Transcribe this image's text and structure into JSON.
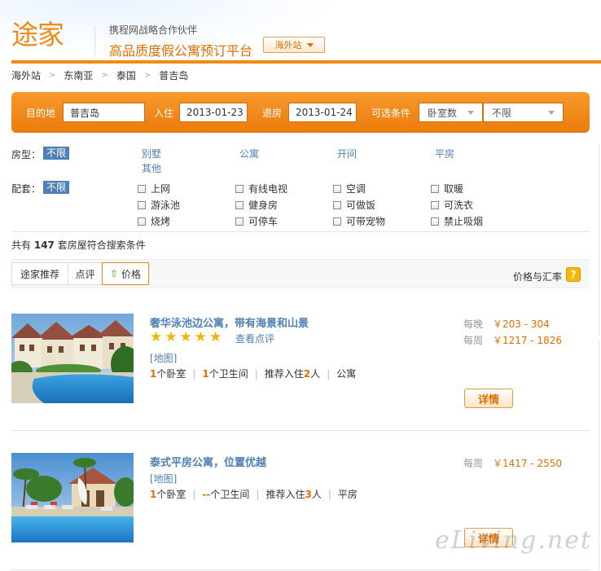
{
  "header": {
    "logo": "途家",
    "partner": "携程网战略合作伙伴",
    "slogan": "高品质度假公寓预订平台",
    "site_switch": "海外站"
  },
  "breadcrumb": [
    "海外站",
    "东南亚",
    "泰国",
    "普吉岛"
  ],
  "search": {
    "destination_label": "目的地",
    "destination_value": "普吉岛",
    "checkin_label": "入住",
    "checkin_value": "2013-01-23",
    "checkout_label": "退房",
    "checkout_value": "2013-01-24",
    "optional_label": "可选条件",
    "bedrooms_select": "卧室数",
    "unlimited_select": "不限"
  },
  "filters": {
    "room_type_label": "房型：",
    "room_type_selected": "不限",
    "room_types": [
      "别墅",
      "公寓",
      "开间",
      "平房",
      "其他"
    ],
    "amenities_label": "配套：",
    "amenities_selected": "不限",
    "amenities": [
      "上网",
      "有线电视",
      "空调",
      "取暖",
      "游泳池",
      "健身房",
      "可做饭",
      "可洗衣",
      "烧烤",
      "可停车",
      "可带宠物",
      "禁止吸烟"
    ]
  },
  "results": {
    "prefix": "共有",
    "count": "147",
    "suffix": "套房屋符合搜索条件"
  },
  "sort": {
    "tabs": [
      "途家推荐",
      "点评",
      "价格"
    ],
    "rate_label": "价格与汇率",
    "help": "?"
  },
  "listings": [
    {
      "title": "奢华泳池边公寓，带有海景和山景",
      "rating": 5,
      "review_link": "查看点评",
      "map": "[地图]",
      "bedrooms_num": "1",
      "bedrooms_unit": "个卧室",
      "bathrooms_num": "1",
      "bathrooms_unit": "个卫生间",
      "guests_prefix": "推荐入住",
      "guests_num": "2",
      "guests_unit": "人",
      "type": "公寓",
      "prices": [
        {
          "label": "每晚",
          "value": "￥203 - 304"
        },
        {
          "label": "每周",
          "value": "￥1217 - 1826"
        }
      ],
      "detail": "详情"
    },
    {
      "title": "泰式平房公寓，位置优越",
      "rating": 0,
      "review_link": "",
      "map": "[地图]",
      "bedrooms_num": "1",
      "bedrooms_unit": "个卧室",
      "bathrooms_num": "--",
      "bathrooms_unit": "个卫生间",
      "guests_prefix": "推荐入住",
      "guests_num": "3",
      "guests_unit": "人",
      "type": "平房",
      "prices": [
        {
          "label": "每周",
          "value": "￥1417 - 2550"
        }
      ],
      "detail": "详情"
    }
  ],
  "watermark": "eLiving.net",
  "colors": {
    "brand_orange": "#f08a14",
    "link_blue": "#4e7fb6",
    "price_orange": "#e06e00",
    "star_gold": "#f6b400"
  }
}
